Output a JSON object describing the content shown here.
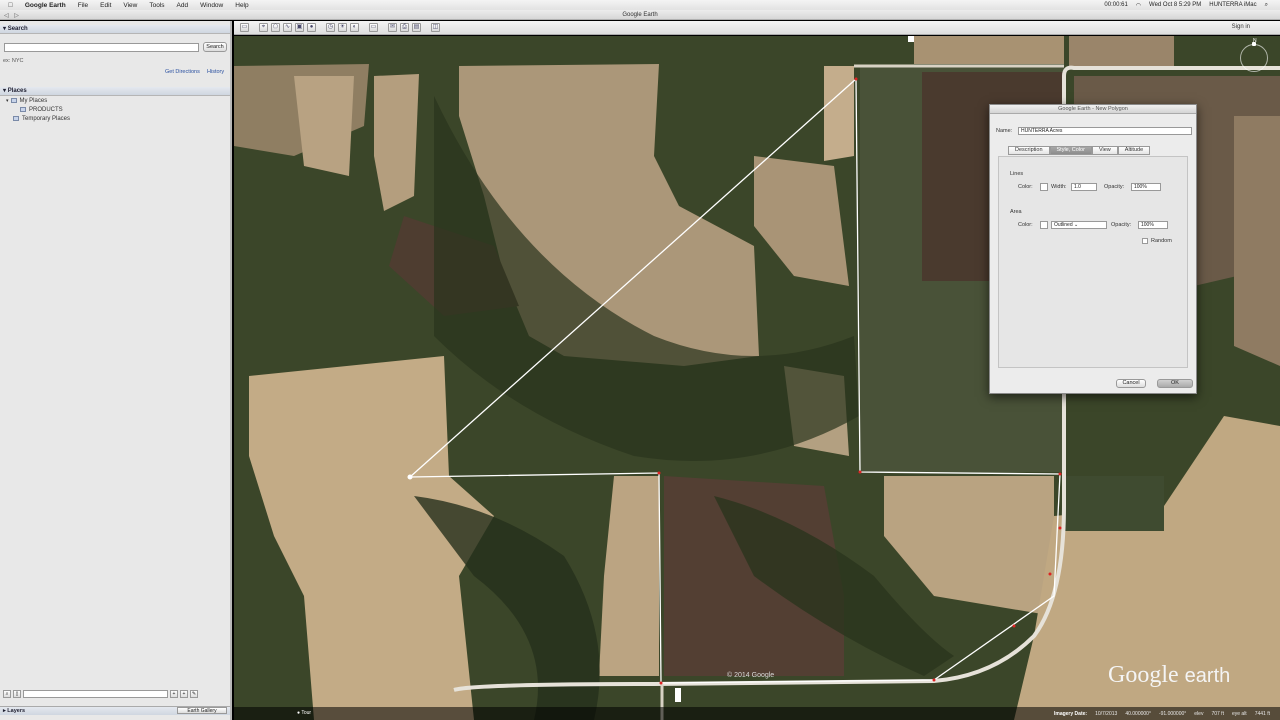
{
  "menubar": {
    "app": "Google Earth",
    "items": [
      "File",
      "Edit",
      "View",
      "Tools",
      "Add",
      "Window",
      "Help"
    ],
    "clock": "Wed Oct 8  5:29 PM",
    "user": "HUNTERRA iMac",
    "battery": "00:00:61"
  },
  "window": {
    "title": "Google Earth"
  },
  "toolbar": {
    "sign_in": "Sign in"
  },
  "search": {
    "header": "Search",
    "button": "Search",
    "result": "ex: NYC",
    "get_directions": "Get Directions",
    "history": "History"
  },
  "places": {
    "header": "Places",
    "items": [
      "My Places",
      "PRODUCTS",
      "Temporary Places"
    ]
  },
  "layers": {
    "header": "Layers",
    "gallery": "Earth Gallery"
  },
  "dialog": {
    "title": "Google Earth - New Polygon",
    "name_label": "Name:",
    "name_value": "HUNTERRA Acres",
    "tabs": [
      "Description",
      "Style, Color",
      "View",
      "Altitude"
    ],
    "active_tab": 1,
    "lines_label": "Lines",
    "line_color_label": "Color:",
    "width_label": "Width:",
    "width_value": "1.0",
    "line_opacity_label": "Opacity:",
    "line_opacity_value": "100%",
    "area_label": "Area",
    "area_color_label": "Color:",
    "area_fill_value": "Outlined",
    "area_opacity_label": "Opacity:",
    "area_opacity_value": "100%",
    "random_label": "Random",
    "cancel": "Cancel",
    "ok": "OK"
  },
  "map": {
    "copyright": "© 2014 Google",
    "tour": "Tour",
    "logo_word": "Google",
    "logo_suffix": "earth",
    "compass_n": "N"
  },
  "statusbar": {
    "imagery_label": "Imagery Date:",
    "imagery_date": "10/7/2013",
    "lat": "40.000000°",
    "lon": "-91.000000°",
    "elev_label": "elev",
    "elev": "707 ft",
    "eye_label": "eye alt",
    "eye": "7441 ft"
  },
  "colors": {
    "field_tan": "#b39d7f",
    "field_light": "#c7b08a",
    "field_dark": "#5a4a3c",
    "trees": "#2f3a22",
    "grass": "#4c5738",
    "road": "#e6e2d9",
    "polygon_line": "#ffffff"
  }
}
